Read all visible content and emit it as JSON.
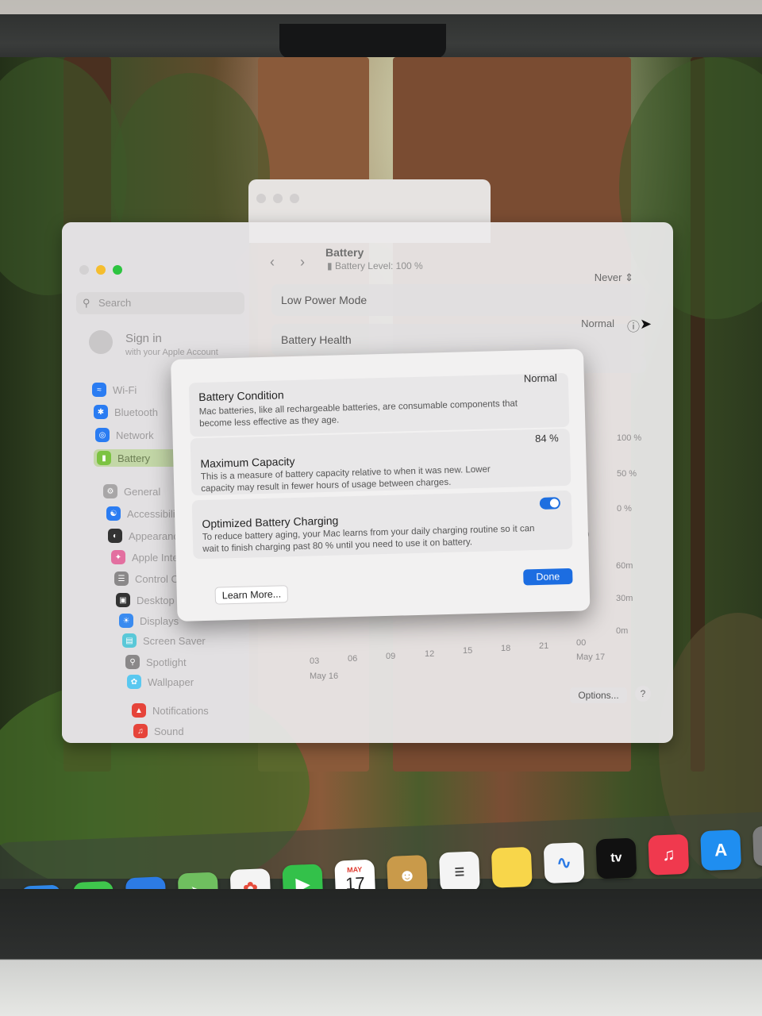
{
  "sidebar": {
    "search_placeholder": "Search",
    "signin_title": "Sign in",
    "signin_subtitle": "with your Apple Account",
    "items": [
      "Wi-Fi",
      "Bluetooth",
      "Network",
      "Battery",
      "General",
      "Accessibili",
      "Appearanc",
      "Apple Intel",
      "Control Ce",
      "Desktop &",
      "Displays",
      "Screen Saver",
      "Spotlight",
      "Wallpaper",
      "Notifications",
      "Sound"
    ]
  },
  "header": {
    "title": "Battery",
    "subtitle": "Battery Level: 100 %"
  },
  "settings": {
    "low_power_label": "Low Power Mode",
    "low_power_value": "Never",
    "battery_health_label": "Battery Health",
    "battery_health_value": "Normal",
    "partial_row_text": "s",
    "axis_pct": [
      "100 %",
      "50 %",
      "0 %"
    ],
    "axis_min": [
      "60m",
      "30m",
      "0m"
    ],
    "axis_mid_zero": "0",
    "x_ticks": [
      "03",
      "06",
      "09",
      "12",
      "15",
      "18",
      "21",
      "00"
    ],
    "date_start": "May 16",
    "date_end": "May 17",
    "options_label": "Options...",
    "help_label": "?"
  },
  "sheet": {
    "condition_title": "Battery Condition",
    "condition_value": "Normal",
    "condition_desc": "Mac batteries, like all rechargeable batteries, are consumable components that become less effective as they age.",
    "capacity_title": "Maximum Capacity",
    "capacity_value": "84 %",
    "capacity_desc": "This is a measure of battery capacity relative to when it was new. Lower capacity may result in fewer hours of usage between charges.",
    "optimized_title": "Optimized Battery Charging",
    "optimized_desc": "To reduce battery aging, your Mac learns from your daily charging routine so it can wait to finish charging past 80 % until you need to use it on battery.",
    "learn_more_label": "Learn More...",
    "done_label": "Done"
  },
  "dock": {
    "calendar_month": "MAY",
    "calendar_day": "17",
    "tv_label": "tv"
  }
}
